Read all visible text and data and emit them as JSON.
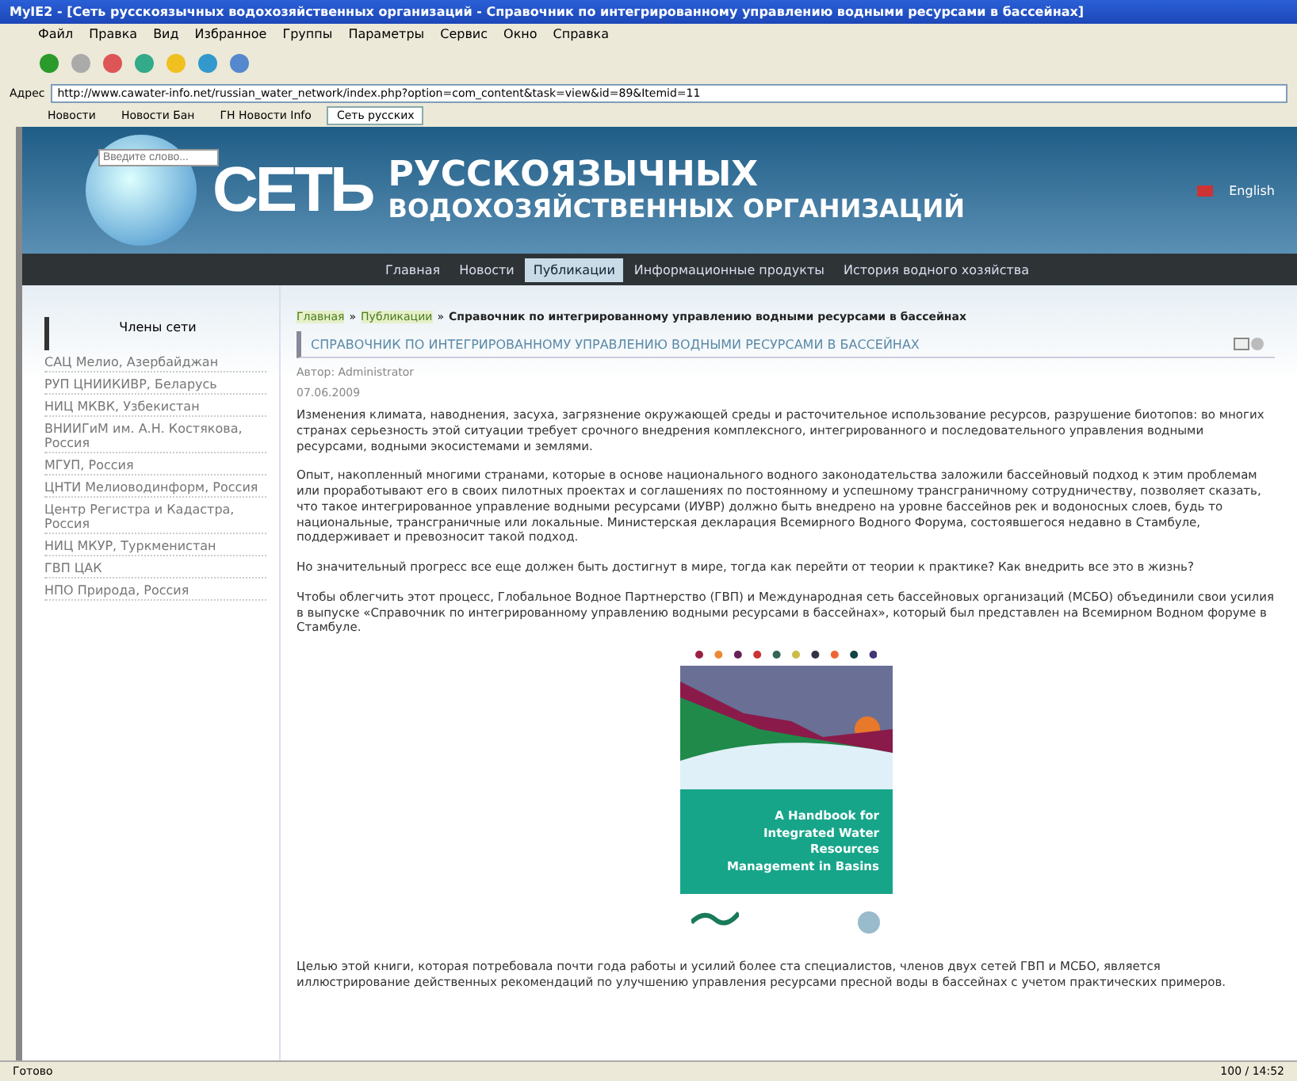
{
  "window": {
    "title": "MyIE2 - [Сеть русскоязычных водохозяйственных организаций - Справочник по интегрированному управлению водными ресурсами в бассейнах]"
  },
  "menu": [
    "Файл",
    "Правка",
    "Вид",
    "Избранное",
    "Группы",
    "Параметры",
    "Сервис",
    "Окно",
    "Справка"
  ],
  "address": {
    "label": "Адрес",
    "value": "http://www.cawater-info.net/russian_water_network/index.php?option=com_content&task=view&id=89&Itemid=11"
  },
  "links": [
    {
      "label": "Новости",
      "selected": false
    },
    {
      "label": "Новости Бан",
      "selected": false
    },
    {
      "label": "ГН Новости Info",
      "selected": false
    },
    {
      "label": "Сеть русских",
      "selected": true
    }
  ],
  "site": {
    "logo": "СЕТЬ",
    "title_line1": "РУССКОЯЗЫЧНЫХ",
    "title_line2": "ВОДОХОЗЯЙСТВЕННЫХ ОРГАНИЗАЦИЙ",
    "search_placeholder": "Введите слово...",
    "language": "English"
  },
  "nav": [
    {
      "label": "Главная",
      "selected": false
    },
    {
      "label": "Новости",
      "selected": false
    },
    {
      "label": "Публикации",
      "selected": true
    },
    {
      "label": "Информационные продукты",
      "selected": false
    },
    {
      "label": "История водного хозяйства",
      "selected": false
    }
  ],
  "sidebar": {
    "title": "Члены сети",
    "items": [
      "САЦ Мелио, Азербайджан",
      "РУП ЦНИИКИВР, Беларусь",
      "НИЦ МКВК, Узбекистан",
      "ВНИИГиМ им. А.Н. Костякова, Россия",
      "МГУП, Россия",
      "ЦНТИ Мелиоводинформ, Россия",
      "Центр Регистра и Кадастра, Россия",
      "НИЦ МКУР, Туркменистан",
      "ГВП ЦАК",
      "НПО Природа, Россия"
    ]
  },
  "breadcrumb_separator": "»",
  "breadcrumb": [
    "Главная",
    "Публикации",
    "Справочник по интегрированному управлению водными ресурсами в бассейнах"
  ],
  "article": {
    "title": "СПРАВОЧНИК ПО ИНТЕГРИРОВАННОМУ УПРАВЛЕНИЮ ВОДНЫМИ РЕСУРСАМИ В БАССЕЙНАХ",
    "author": "Автор: Administrator",
    "date": "07.06.2009",
    "paragraphs": [
      "Изменения климата, наводнения, засуха, загрязнение окружающей среды и расточительное использование ресурсов, разрушение биотопов: во многих странах серьезность этой ситуации требует срочного внедрения комплексного, интегрированного и последовательного управления водными ресурсами, водными экосистемами и землями.",
      "Опыт, накопленный многими странами, которые в основе национального водного законодательства заложили бассейновый подход к этим проблемам или проработывают его в своих пилотных проектах и соглашениях по постоянному и успешному трансграничному сотрудничеству, позволяет сказать, что такое интегрированное управление водными ресурсами (ИУВР) должно быть внедрено на уровне бассейнов рек и водоносных слоев, будь то национальные, трансграничные или локальные. Министерская декларация Всемирного Водного Форума, состоявшегося недавно в Стамбуле, поддерживает и превозносит такой подход.",
      "Но значительный прогресс все еще должен быть достигнут в мире, тогда как перейти от теории к практике? Как внедрить все это в жизнь?",
      "Чтобы облегчить этот процесс, Глобальное Водное Партнерство (ГВП) и Международная сеть бассейновых организаций (МСБО) объединили свои усилия в выпуске «Справочник по интегрированному управлению водными ресурсами в бассейнах», который был представлен на Всемирном Водном форуме в Стамбуле."
    ],
    "cover_text": "A Handbook for Integrated Water Resources Management in Basins",
    "closing": "Целью этой книги, которая потребовала почти года работы и усилий более ста специалистов, членов двух сетей ГВП и МСБО, является иллюстрирование действенных рекомендаций по улучшению управления ресурсами пресной воды в бассейнах с учетом практических примеров."
  },
  "status_bar": {
    "text": "Готово",
    "time": "100 / 14:52"
  }
}
